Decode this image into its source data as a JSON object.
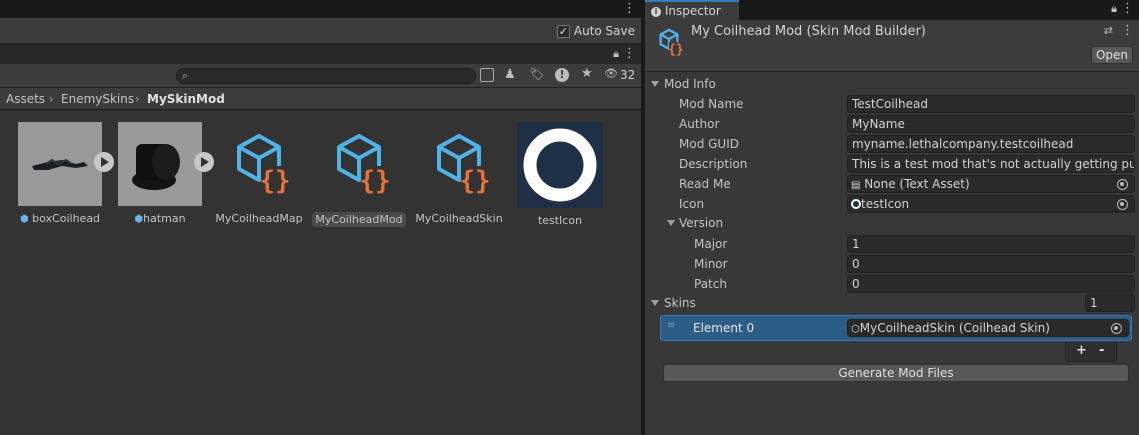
{
  "toolbar": {
    "auto_save_label": "Auto Save",
    "auto_save_checked": true
  },
  "project": {
    "search_placeholder": "",
    "hidden_count": "32",
    "breadcrumb": [
      "Assets",
      "EnemySkins",
      "MySkinMod"
    ],
    "assets": [
      {
        "name": "boxCoilhead",
        "kind": "model",
        "selected": false
      },
      {
        "name": "hatman",
        "kind": "model",
        "selected": false
      },
      {
        "name": "MyCoilheadMap",
        "kind": "script-object",
        "selected": false
      },
      {
        "name": "MyCoilheadMod",
        "kind": "script-object",
        "selected": true
      },
      {
        "name": "MyCoilheadSkin",
        "kind": "script-object",
        "selected": false
      },
      {
        "name": "testIcon",
        "kind": "texture",
        "selected": false
      }
    ]
  },
  "inspector": {
    "tab_label": "Inspector",
    "object_title": "My Coilhead Mod (Skin Mod Builder)",
    "open_button": "Open",
    "mod_info_label": "Mod Info",
    "fields": {
      "mod_name": {
        "label": "Mod Name",
        "value": "TestCoilhead"
      },
      "author": {
        "label": "Author",
        "value": "MyName"
      },
      "mod_guid": {
        "label": "Mod GUID",
        "value": "myname.lethalcompany.testcoilhead"
      },
      "description": {
        "label": "Description",
        "value": "This is a test mod that's not actually getting publis"
      },
      "read_me": {
        "label": "Read Me",
        "value": "None (Text Asset)"
      },
      "icon": {
        "label": "Icon",
        "value": "testIcon"
      }
    },
    "version": {
      "label": "Version",
      "major": {
        "label": "Major",
        "value": "1"
      },
      "minor": {
        "label": "Minor",
        "value": "0"
      },
      "patch": {
        "label": "Patch",
        "value": "0"
      }
    },
    "skins": {
      "label": "Skins",
      "count": "1",
      "elements": [
        {
          "label": "Element 0",
          "value": "MyCoilheadSkin (Coilhead Skin)"
        }
      ],
      "add_label": "+",
      "remove_label": "-"
    },
    "generate_button": "Generate Mod Files"
  },
  "colors": {
    "accent_blue": "#3a79bb",
    "icon_cyan": "#4fb3e8",
    "icon_orange": "#e8703a",
    "selection_bg": "#2c5d87"
  }
}
